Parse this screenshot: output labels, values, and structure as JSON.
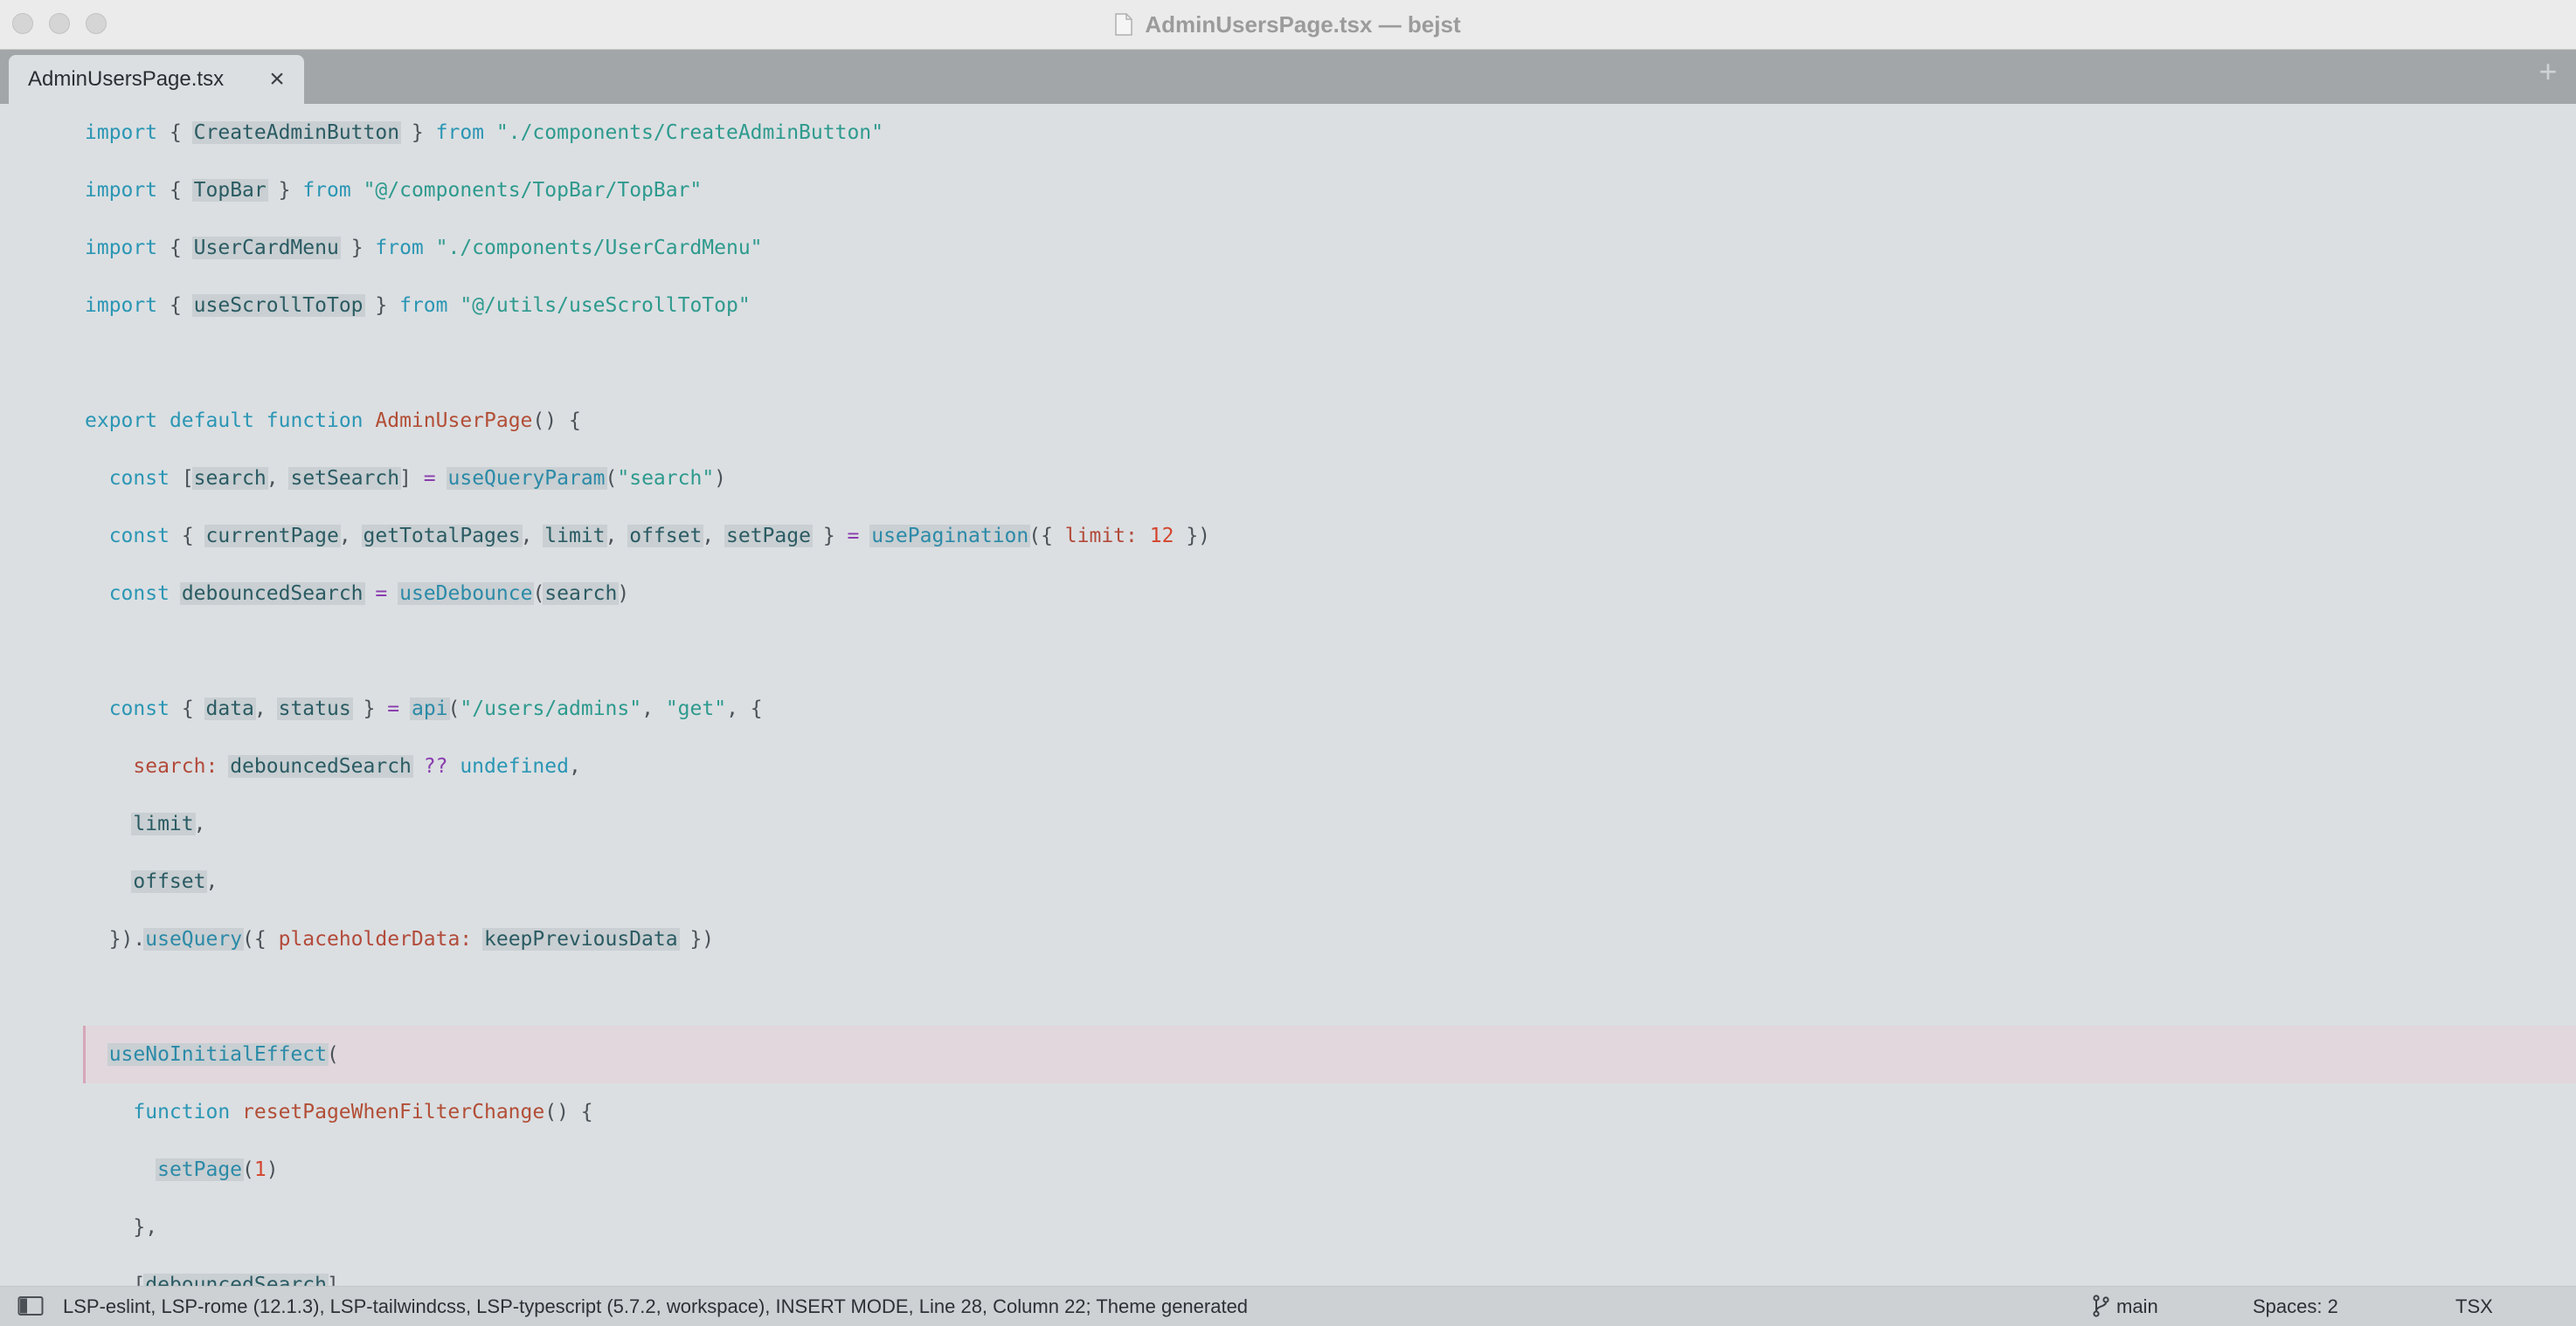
{
  "window": {
    "title": "AdminUsersPage.tsx — bejst",
    "colors": {
      "titlebar": "#ebebeb",
      "tabbar": "#a2a6a9",
      "editor_bg": "#dbdfe2",
      "highlight_line": "#e1d7dd"
    }
  },
  "tabs": [
    {
      "label": "AdminUsersPage.tsx",
      "close_glyph": "×",
      "active": true
    }
  ],
  "new_tab_glyph": "+",
  "editor": {
    "lines": [
      [
        "import",
        " { ",
        "CreateAdminButton",
        " } ",
        "from",
        " \"./components/CreateAdminButton\""
      ],
      [
        "import",
        " { ",
        "TopBar",
        " } ",
        "from",
        " \"@/components/TopBar/TopBar\""
      ],
      [
        "import",
        " { ",
        "UserCardMenu",
        " } ",
        "from",
        " \"./components/UserCardMenu\""
      ],
      [
        "import",
        " { ",
        "useScrollToTop",
        " } ",
        "from",
        " \"@/utils/useScrollToTop\""
      ],
      [],
      [
        "export",
        " ",
        "default",
        " ",
        "function",
        " ",
        "AdminUserPage",
        "() {"
      ],
      [
        "  ",
        "const",
        " [",
        "search",
        ", ",
        "setSearch",
        "] ",
        "=",
        " ",
        "useQueryParam",
        "(",
        "\"search\"",
        ")"
      ],
      [
        "  ",
        "const",
        " { ",
        "currentPage",
        ", ",
        "getTotalPages",
        ", ",
        "limit",
        ", ",
        "offset",
        ", ",
        "setPage",
        " } ",
        "=",
        " ",
        "usePagination",
        "({ ",
        "limit:",
        " ",
        "12",
        " })"
      ],
      [
        "  ",
        "const",
        " ",
        "debouncedSearch",
        " ",
        "=",
        " ",
        "useDebounce",
        "(",
        "search",
        ")"
      ],
      [],
      [
        "  ",
        "const",
        " { ",
        "data",
        ", ",
        "status",
        " } ",
        "=",
        " ",
        "api",
        "(",
        "\"/users/admins\"",
        ", ",
        "\"get\"",
        ", {"
      ],
      [
        "    ",
        "search:",
        " ",
        "debouncedSearch",
        " ",
        "??",
        " ",
        "undefined",
        ","
      ],
      [
        "    ",
        "limit",
        ","
      ],
      [
        "    ",
        "offset",
        ","
      ],
      [
        "  ",
        "})",
        ".",
        "useQuery",
        "({ ",
        "placeholderData:",
        " ",
        "keepPreviousData",
        " })"
      ],
      [],
      [
        "  ",
        "useNoInitialEffect",
        "("
      ],
      [
        "    ",
        "function",
        " ",
        "resetPageWhenFilterChange",
        "() {"
      ],
      [
        "      ",
        "setPage",
        "(",
        "1",
        ")"
      ],
      [
        "    ",
        "},"
      ],
      [
        "    ",
        "[",
        "debouncedSearch",
        "],"
      ]
    ],
    "highlighted_line": 16
  },
  "status_bar": {
    "sidebar_icon": "sidebar-toggle-icon",
    "text": "LSP-eslint, LSP-rome (12.1.3), LSP-tailwindcss, LSP-typescript (5.7.2, workspace), INSERT MODE, Line 28, Column 22; Theme generated",
    "branch_icon": "git-branch-icon",
    "branch": "main",
    "spaces": "Spaces: 2",
    "syntax": "TSX"
  }
}
